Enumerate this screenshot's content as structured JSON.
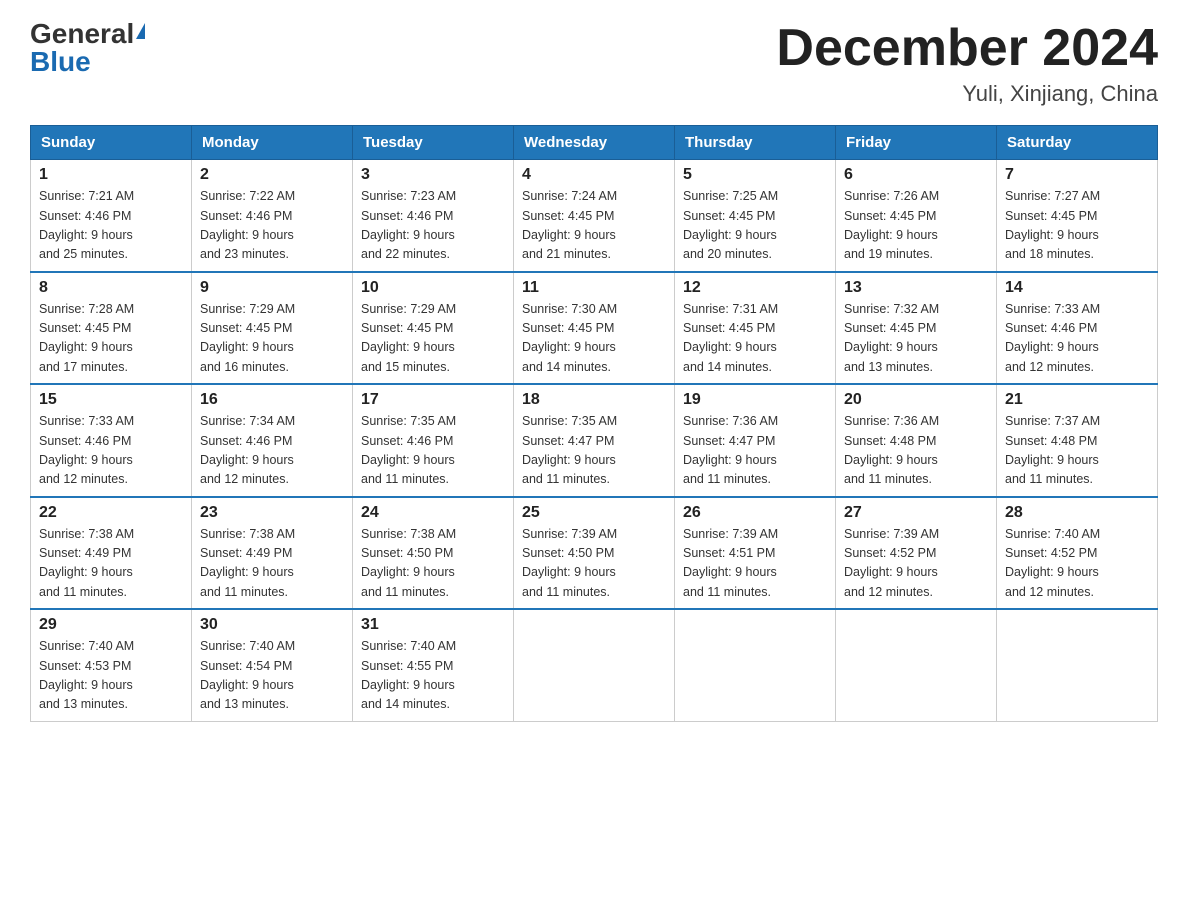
{
  "header": {
    "logo_general": "General",
    "logo_blue": "Blue",
    "month_title": "December 2024",
    "location": "Yuli, Xinjiang, China"
  },
  "days_of_week": [
    "Sunday",
    "Monday",
    "Tuesday",
    "Wednesday",
    "Thursday",
    "Friday",
    "Saturday"
  ],
  "weeks": [
    [
      {
        "day": "1",
        "sunrise": "7:21 AM",
        "sunset": "4:46 PM",
        "daylight": "9 hours and 25 minutes."
      },
      {
        "day": "2",
        "sunrise": "7:22 AM",
        "sunset": "4:46 PM",
        "daylight": "9 hours and 23 minutes."
      },
      {
        "day": "3",
        "sunrise": "7:23 AM",
        "sunset": "4:46 PM",
        "daylight": "9 hours and 22 minutes."
      },
      {
        "day": "4",
        "sunrise": "7:24 AM",
        "sunset": "4:45 PM",
        "daylight": "9 hours and 21 minutes."
      },
      {
        "day": "5",
        "sunrise": "7:25 AM",
        "sunset": "4:45 PM",
        "daylight": "9 hours and 20 minutes."
      },
      {
        "day": "6",
        "sunrise": "7:26 AM",
        "sunset": "4:45 PM",
        "daylight": "9 hours and 19 minutes."
      },
      {
        "day": "7",
        "sunrise": "7:27 AM",
        "sunset": "4:45 PM",
        "daylight": "9 hours and 18 minutes."
      }
    ],
    [
      {
        "day": "8",
        "sunrise": "7:28 AM",
        "sunset": "4:45 PM",
        "daylight": "9 hours and 17 minutes."
      },
      {
        "day": "9",
        "sunrise": "7:29 AM",
        "sunset": "4:45 PM",
        "daylight": "9 hours and 16 minutes."
      },
      {
        "day": "10",
        "sunrise": "7:29 AM",
        "sunset": "4:45 PM",
        "daylight": "9 hours and 15 minutes."
      },
      {
        "day": "11",
        "sunrise": "7:30 AM",
        "sunset": "4:45 PM",
        "daylight": "9 hours and 14 minutes."
      },
      {
        "day": "12",
        "sunrise": "7:31 AM",
        "sunset": "4:45 PM",
        "daylight": "9 hours and 14 minutes."
      },
      {
        "day": "13",
        "sunrise": "7:32 AM",
        "sunset": "4:45 PM",
        "daylight": "9 hours and 13 minutes."
      },
      {
        "day": "14",
        "sunrise": "7:33 AM",
        "sunset": "4:46 PM",
        "daylight": "9 hours and 12 minutes."
      }
    ],
    [
      {
        "day": "15",
        "sunrise": "7:33 AM",
        "sunset": "4:46 PM",
        "daylight": "9 hours and 12 minutes."
      },
      {
        "day": "16",
        "sunrise": "7:34 AM",
        "sunset": "4:46 PM",
        "daylight": "9 hours and 12 minutes."
      },
      {
        "day": "17",
        "sunrise": "7:35 AM",
        "sunset": "4:46 PM",
        "daylight": "9 hours and 11 minutes."
      },
      {
        "day": "18",
        "sunrise": "7:35 AM",
        "sunset": "4:47 PM",
        "daylight": "9 hours and 11 minutes."
      },
      {
        "day": "19",
        "sunrise": "7:36 AM",
        "sunset": "4:47 PM",
        "daylight": "9 hours and 11 minutes."
      },
      {
        "day": "20",
        "sunrise": "7:36 AM",
        "sunset": "4:48 PM",
        "daylight": "9 hours and 11 minutes."
      },
      {
        "day": "21",
        "sunrise": "7:37 AM",
        "sunset": "4:48 PM",
        "daylight": "9 hours and 11 minutes."
      }
    ],
    [
      {
        "day": "22",
        "sunrise": "7:38 AM",
        "sunset": "4:49 PM",
        "daylight": "9 hours and 11 minutes."
      },
      {
        "day": "23",
        "sunrise": "7:38 AM",
        "sunset": "4:49 PM",
        "daylight": "9 hours and 11 minutes."
      },
      {
        "day": "24",
        "sunrise": "7:38 AM",
        "sunset": "4:50 PM",
        "daylight": "9 hours and 11 minutes."
      },
      {
        "day": "25",
        "sunrise": "7:39 AM",
        "sunset": "4:50 PM",
        "daylight": "9 hours and 11 minutes."
      },
      {
        "day": "26",
        "sunrise": "7:39 AM",
        "sunset": "4:51 PM",
        "daylight": "9 hours and 11 minutes."
      },
      {
        "day": "27",
        "sunrise": "7:39 AM",
        "sunset": "4:52 PM",
        "daylight": "9 hours and 12 minutes."
      },
      {
        "day": "28",
        "sunrise": "7:40 AM",
        "sunset": "4:52 PM",
        "daylight": "9 hours and 12 minutes."
      }
    ],
    [
      {
        "day": "29",
        "sunrise": "7:40 AM",
        "sunset": "4:53 PM",
        "daylight": "9 hours and 13 minutes."
      },
      {
        "day": "30",
        "sunrise": "7:40 AM",
        "sunset": "4:54 PM",
        "daylight": "9 hours and 13 minutes."
      },
      {
        "day": "31",
        "sunrise": "7:40 AM",
        "sunset": "4:55 PM",
        "daylight": "9 hours and 14 minutes."
      },
      null,
      null,
      null,
      null
    ]
  ]
}
